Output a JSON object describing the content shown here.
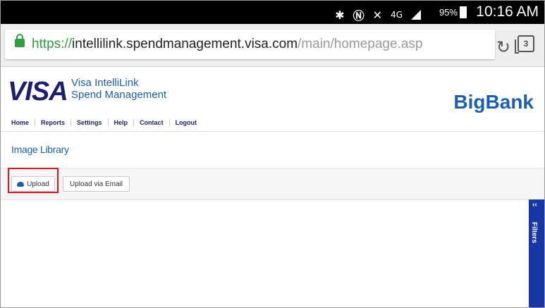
{
  "status_bar": {
    "battery_percent": "95%",
    "time": "10:16 AM",
    "icons": [
      "bluetooth-icon",
      "nfc-icon",
      "mute-icon",
      "lte-icon",
      "signal-icon",
      "battery-icon"
    ]
  },
  "browser": {
    "url_scheme": "https://",
    "url_host": "intellilink.spendmanagement.visa.com",
    "url_path": "/main/homepage.asp",
    "tab_count": "3"
  },
  "header": {
    "visa_logo": "VISA",
    "product_line1": "Visa IntelliLink",
    "product_line2": "Spend Management",
    "bank_logo": "BigBank"
  },
  "nav": {
    "items": [
      "Home",
      "Reports",
      "Settings",
      "Help",
      "Contact",
      "Logout"
    ]
  },
  "main": {
    "title": "Image Library",
    "upload_label": "Upload",
    "upload_email_label": "Upload via Email"
  },
  "filters": {
    "chevron": "‹‹",
    "label": "Filters"
  },
  "colors": {
    "visa_blue": "#1a1f71",
    "link_blue": "#1a5fb4",
    "filters_blue": "#1737a6",
    "highlight_red": "#e0161c",
    "secure_green": "#2e9e3f"
  }
}
